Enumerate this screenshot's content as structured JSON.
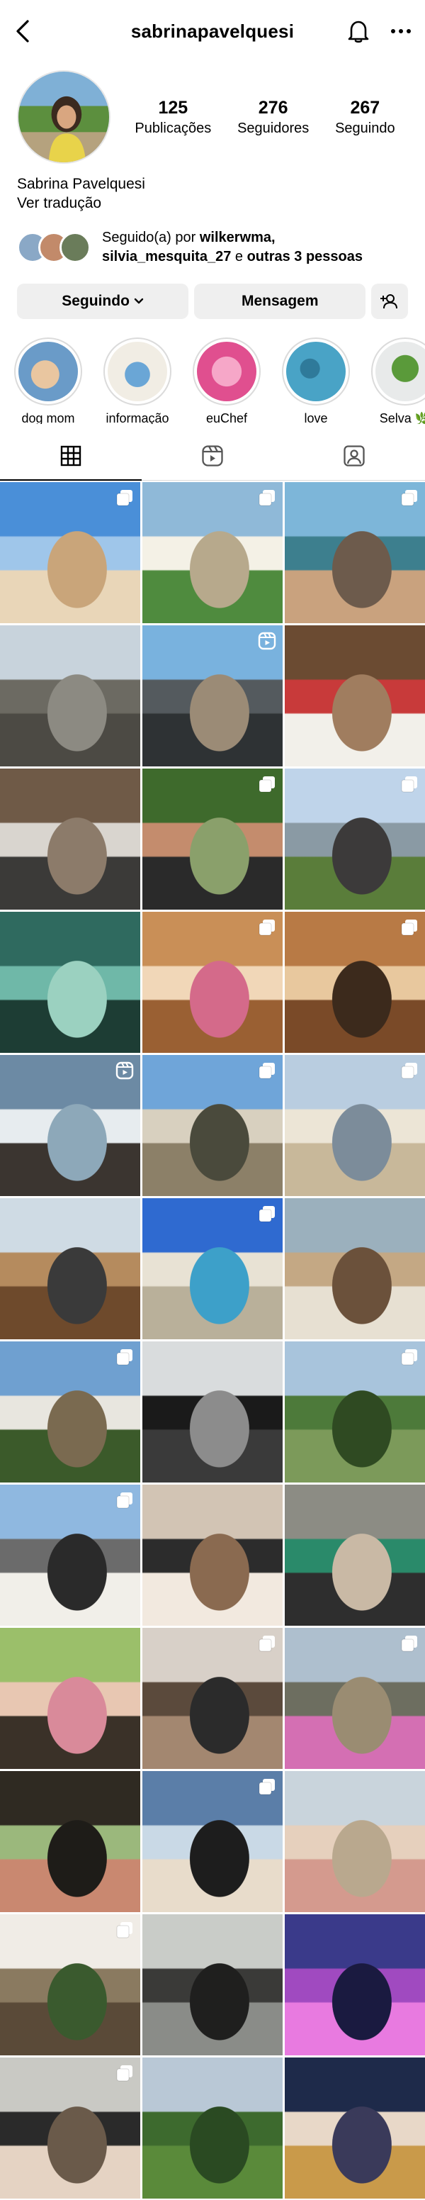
{
  "header": {
    "username": "sabrinapavelquesi",
    "back_icon": "chevron-left-icon",
    "bell_icon": "bell-icon",
    "more_icon": "more-horizontal-icon"
  },
  "profile": {
    "stats": [
      {
        "num": "125",
        "label": "Publicações"
      },
      {
        "num": "276",
        "label": "Seguidores"
      },
      {
        "num": "267",
        "label": "Seguindo"
      }
    ],
    "name": "Sabrina Pavelquesi",
    "translate": "Ver tradução",
    "followed_prefix": "Seguido(a) por ",
    "followed_user1": "wilkerwma,",
    "followed_user2": "silvia_mesquita_27",
    "followed_mid": " e ",
    "followed_others": "outras 3 pessoas"
  },
  "actions": {
    "following": "Seguindo",
    "message": "Mensagem"
  },
  "highlights": [
    {
      "label": "dog mom"
    },
    {
      "label": "informação"
    },
    {
      "label": "euChef"
    },
    {
      "label": "love"
    },
    {
      "label": "Selva 🌿"
    }
  ],
  "tabs": [
    "grid-icon",
    "reels-icon",
    "tagged-icon"
  ],
  "colors": {
    "button_bg": "#efefef",
    "divider": "#dbdbdb"
  },
  "posts": [
    {
      "badge": "multi",
      "colors": [
        "#4a8fd8",
        "#9fc6ea",
        "#e9d6b8",
        "#c9a57a"
      ]
    },
    {
      "badge": "multi",
      "colors": [
        "#8fb9d8",
        "#f4f1e6",
        "#4f8b3e",
        "#b7a98c"
      ]
    },
    {
      "badge": "multi",
      "colors": [
        "#7db6d9",
        "#3d7f8e",
        "#c9a27e",
        "#6d5b4c"
      ]
    },
    {
      "badge": "none",
      "colors": [
        "#c8d3dc",
        "#6c6a62",
        "#4c4a44",
        "#8c8a82"
      ]
    },
    {
      "badge": "reel",
      "colors": [
        "#79b2de",
        "#545a5e",
        "#2e3234",
        "#9b8b76"
      ]
    },
    {
      "badge": "none",
      "colors": [
        "#6b4b32",
        "#c83a3a",
        "#f2f0ea",
        "#a07d5f"
      ]
    },
    {
      "badge": "none",
      "colors": [
        "#6f5a47",
        "#d9d5cf",
        "#3b3a38",
        "#8c7b6a"
      ]
    },
    {
      "badge": "multi",
      "colors": [
        "#3e6a2c",
        "#c48c6d",
        "#2a2a2a",
        "#8aa06b"
      ]
    },
    {
      "badge": "multi",
      "colors": [
        "#bfd4ea",
        "#8a9aa4",
        "#5a7d3a",
        "#3c3a3a"
      ]
    },
    {
      "badge": "none",
      "colors": [
        "#2f6a5f",
        "#6fb8a8",
        "#1d3d34",
        "#9bd1c0"
      ]
    },
    {
      "badge": "multi",
      "colors": [
        "#c98f57",
        "#f1d7b8",
        "#9a6033",
        "#d46a8a"
      ]
    },
    {
      "badge": "multi",
      "colors": [
        "#b87a45",
        "#e8c89e",
        "#7a4a28",
        "#3c2a1c"
      ]
    },
    {
      "badge": "reel",
      "colors": [
        "#6c8aa4",
        "#e7ecef",
        "#3b3530",
        "#8da8b9"
      ]
    },
    {
      "badge": "multi",
      "colors": [
        "#6fa5d9",
        "#d8d0bf",
        "#8c8068",
        "#4a4a3c"
      ]
    },
    {
      "badge": "multi",
      "colors": [
        "#b9cde0",
        "#ece5d6",
        "#c8b89a",
        "#7c8c9a"
      ]
    },
    {
      "badge": "none",
      "colors": [
        "#cfdbe4",
        "#b58b5e",
        "#6e4a2c",
        "#3a3a3a"
      ]
    },
    {
      "badge": "multi",
      "colors": [
        "#2f6ad0",
        "#e8e2d4",
        "#b9b09a",
        "#3da0c9"
      ]
    },
    {
      "badge": "none",
      "colors": [
        "#9bb0bd",
        "#c4a884",
        "#e7e0d2",
        "#6b513b"
      ]
    },
    {
      "badge": "multi",
      "colors": [
        "#6fa0d0",
        "#e8e6df",
        "#3b5a2a",
        "#7a6a50"
      ]
    },
    {
      "badge": "none",
      "colors": [
        "#d9dcdd",
        "#1a1a1a",
        "#3a3a3a",
        "#8c8c8c"
      ]
    },
    {
      "badge": "multi",
      "colors": [
        "#a8c4dc",
        "#4d7a3a",
        "#7c9a5a",
        "#2f4a22"
      ]
    },
    {
      "badge": "multi",
      "colors": [
        "#8fb8e0",
        "#6b6b6b",
        "#f1efe9",
        "#2a2a2a"
      ]
    },
    {
      "badge": "none",
      "colors": [
        "#d2c4b4",
        "#2c2c2c",
        "#f2e9df",
        "#8a6a50"
      ]
    },
    {
      "badge": "none",
      "colors": [
        "#8c8c84",
        "#2a8a6a",
        "#2e2e2e",
        "#c9b9a5"
      ]
    },
    {
      "badge": "none",
      "colors": [
        "#9bbf6a",
        "#e8c7b2",
        "#3a3128",
        "#d98a9a"
      ]
    },
    {
      "badge": "multi",
      "colors": [
        "#d8d0c8",
        "#5b4a3c",
        "#a38770",
        "#2b2b2b"
      ]
    },
    {
      "badge": "multi",
      "colors": [
        "#aebfce",
        "#6d6e60",
        "#d46fb3",
        "#9a8c72"
      ]
    },
    {
      "badge": "none",
      "colors": [
        "#2f2a22",
        "#9bb87c",
        "#c98870",
        "#1e1c18"
      ]
    },
    {
      "badge": "multi",
      "colors": [
        "#5b7ea8",
        "#c9d9e6",
        "#e8dccb",
        "#1d1d1d"
      ]
    },
    {
      "badge": "none",
      "colors": [
        "#c9d4dc",
        "#e6d0bd",
        "#d49a8e",
        "#b9a88e"
      ]
    },
    {
      "badge": "multi",
      "colors": [
        "#f0ece6",
        "#8a7a60",
        "#5a4a38",
        "#3a5a2e"
      ]
    },
    {
      "badge": "none",
      "colors": [
        "#c9ccc8",
        "#3a3a38",
        "#8a8c88",
        "#1f1f1e"
      ]
    },
    {
      "badge": "none",
      "colors": [
        "#3a3a8a",
        "#a04ac0",
        "#e87ae0",
        "#1a1a40"
      ]
    },
    {
      "badge": "multi",
      "colors": [
        "#c9c9c4",
        "#2a2a2a",
        "#e5d3c3",
        "#6a5a4a"
      ]
    },
    {
      "badge": "none",
      "colors": [
        "#b9c8d6",
        "#3d6a2e",
        "#5a8a3a",
        "#2a4a22"
      ]
    },
    {
      "badge": "none",
      "colors": [
        "#1e2a4a",
        "#e8d8c8",
        "#c99a4a",
        "#3a3a5a"
      ]
    }
  ]
}
